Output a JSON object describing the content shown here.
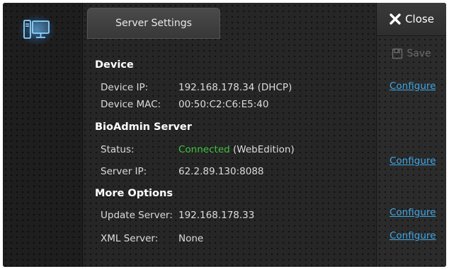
{
  "header": {
    "title": "Server Settings"
  },
  "actions": {
    "close_label": "Close",
    "save_label": "Save"
  },
  "sections": {
    "device": {
      "title": "Device",
      "ip_label": "Device IP:",
      "ip_value": "192.168.178.34 (DHCP)",
      "mac_label": "Device MAC:",
      "mac_value": "00:50:C2:C6:E5:40",
      "configure_label": "Configure"
    },
    "bioadmin": {
      "title": "BioAdmin Server",
      "status_label": "Status:",
      "status_value": "Connected",
      "status_suffix": " (WebEdition)",
      "ip_label": "Server IP:",
      "ip_value": "62.2.89.130:8088",
      "configure_label": "Configure"
    },
    "more": {
      "title": "More Options",
      "update_label": "Update Server:",
      "update_value": "192.168.178.33",
      "update_configure_label": "Configure",
      "xml_label": "XML Server:",
      "xml_value": "None",
      "xml_configure_label": "Configure"
    }
  },
  "colors": {
    "link": "#3fa8e6",
    "connected": "#3ec43e",
    "icon_glow": "#5abeff"
  },
  "icons": {
    "device": "computer-monitor-tower-icon",
    "close": "x-close-icon",
    "save": "floppy-disk-icon"
  }
}
